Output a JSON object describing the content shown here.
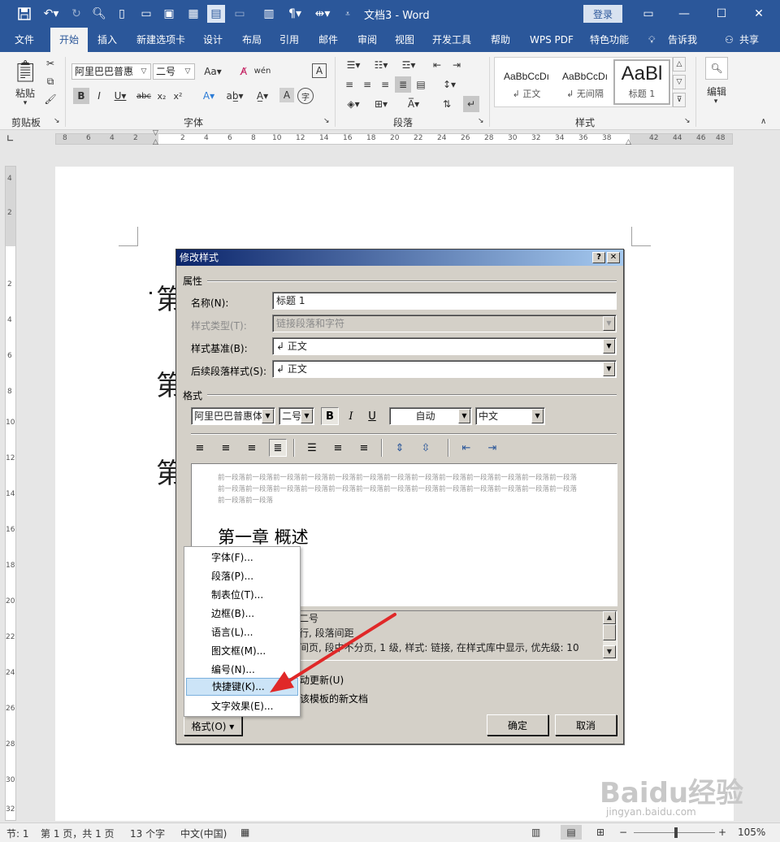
{
  "window": {
    "doc_title": "文档3",
    "app_name": "Word",
    "separator": "-",
    "login_label": "登录"
  },
  "ribbon_tabs": [
    "文件",
    "开始",
    "插入",
    "新建选项卡",
    "设计",
    "布局",
    "引用",
    "邮件",
    "审阅",
    "视图",
    "开发工具",
    "帮助",
    "WPS PDF",
    "特色功能",
    "告诉我",
    "共享"
  ],
  "ribbon": {
    "clipboard_group": "剪贴板",
    "paste_label": "粘贴",
    "font_group": "字体",
    "font_name": "阿里巴巴普惠",
    "font_size": "二号",
    "paragraph_group": "段落",
    "styles_group": "样式",
    "edit_label": "编辑",
    "styles": [
      {
        "preview": "AaBbCcDı",
        "name": "↲ 正文"
      },
      {
        "preview": "AaBbCcDı",
        "name": "↲ 无间隔"
      },
      {
        "preview": "AaBl",
        "name": "标题 1"
      }
    ]
  },
  "ruler": {
    "h_ticks": [
      "8",
      "6",
      "4",
      "2",
      "",
      "2",
      "4",
      "6",
      "8",
      "10",
      "12",
      "14",
      "16",
      "18",
      "20",
      "22",
      "24",
      "26",
      "28",
      "30",
      "32",
      "34",
      "36",
      "38",
      "",
      "42",
      "44",
      "46",
      "48"
    ],
    "v_ticks": [
      "4",
      "2",
      "",
      "2",
      "4",
      "6",
      "8",
      "10",
      "12",
      "14",
      "16",
      "18",
      "20",
      "22",
      "24",
      "26",
      "28",
      "30",
      "32"
    ]
  },
  "page": {
    "heading_chars": [
      "第",
      "第",
      "第"
    ]
  },
  "dialog": {
    "title": "修改样式",
    "help_btn": "?",
    "close_btn": "✕",
    "attributes_label": "属性",
    "name_label": "名称(N):",
    "name_value": "标题 1",
    "type_label": "样式类型(T):",
    "type_value": "链接段落和字符",
    "based_label": "样式基准(B):",
    "based_value": "↲ 正文",
    "next_label": "后续段落样式(S):",
    "next_value": "↲ 正文",
    "format_label": "格式",
    "font_value": "阿里巴巴普惠体",
    "size_value": "二号",
    "bold": "B",
    "italic": "I",
    "underline": "U",
    "color_value": "自动",
    "lang_value": "中文",
    "preview_before": "前一段落前一段落前一段落前一段落前一段落前一段落前一段落前一段落前一段落前一段落前一段落前一段落前一段落前一段落前一段落前一段落前一段落前一段落前一段落前一段落前一段落前一段落前一段落前一段落前一段落前一段落前一段落前一段落",
    "preview_heading": "第一章  概述",
    "desc_lines": [
      "二号",
      "行, 段落间距",
      "间页, 段中不分页, 1 级, 样式: 链接, 在样式库中显示, 优先级: 10"
    ],
    "auto_update": "动更新(U)",
    "template_text": "该模板的新文档",
    "format_btn": "格式(O) ▾",
    "ok_btn": "确定",
    "cancel_btn": "取消"
  },
  "format_menu": [
    "字体(F)...",
    "段落(P)...",
    "制表位(T)...",
    "边框(B)...",
    "语言(L)...",
    "图文框(M)...",
    "编号(N)...",
    "快捷键(K)...",
    "文字效果(E)..."
  ],
  "status": {
    "section": "节: 1",
    "pages": "第 1 页，共 1 页",
    "words": "13 个字",
    "lang": "中文(中国)",
    "zoom": "105%"
  },
  "watermark": {
    "brand": "Baidu经验",
    "url": "jingyan.baidu.com"
  },
  "colors": {
    "title_bar": "#2b579a",
    "dialog_title_start": "#0a246a",
    "highlight": "#cce4f7",
    "arrow": "#e02828"
  }
}
